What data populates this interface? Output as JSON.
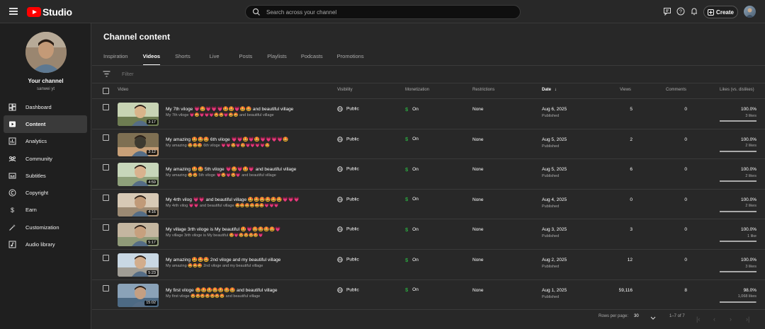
{
  "app": {
    "logo_text": "Studio"
  },
  "search": {
    "placeholder": "Search across your channel"
  },
  "topbar": {
    "create_label": "Create"
  },
  "channel": {
    "title": "Your channel",
    "handle": "sanwei yt"
  },
  "nav": [
    {
      "label": "Dashboard",
      "icon": "dashboard-icon"
    },
    {
      "label": "Content",
      "icon": "content-icon",
      "active": true
    },
    {
      "label": "Analytics",
      "icon": "analytics-icon"
    },
    {
      "label": "Community",
      "icon": "community-icon"
    },
    {
      "label": "Subtitles",
      "icon": "subtitles-icon"
    },
    {
      "label": "Copyright",
      "icon": "copyright-icon"
    },
    {
      "label": "Earn",
      "icon": "earn-icon"
    },
    {
      "label": "Customization",
      "icon": "customization-icon"
    },
    {
      "label": "Audio library",
      "icon": "audio-library-icon"
    }
  ],
  "page": {
    "title": "Channel content"
  },
  "tabs": [
    "Inspiration",
    "Videos",
    "Shorts",
    "Live",
    "Posts",
    "Playlists",
    "Podcasts",
    "Promotions"
  ],
  "active_tab": "Videos",
  "filter": {
    "placeholder": "Filter"
  },
  "columns": {
    "video": "Video",
    "visibility": "Visibility",
    "monetization": "Monetization",
    "restrictions": "Restrictions",
    "date": "Date",
    "views": "Views",
    "comments": "Comments",
    "likes": "Likes (vs. dislikes)"
  },
  "rows": [
    {
      "title": "My 7th viloge 💗🤩💗💗💗🤩🤩💗🤩🤩 and beautiful village",
      "desc": "My 7th viloge 💗🤩💗💗💗🤩🤩💗🤩🤩 and beautiful village",
      "duration": "3:17",
      "visibility": "Public",
      "monetization": "On",
      "restrictions": "None",
      "date": "Aug 6, 2025",
      "status": "Published",
      "views": "5",
      "comments": "0",
      "likes_pct": "100.0%",
      "likes": "3 likes",
      "like_ratio": 1.0
    },
    {
      "title": "My amazing 🤩🤩🤩 6th viloge 💗💗🤩💗🤩💗💗💗💗🤩",
      "desc": "My amazing 🤩🤩🤩 6th viloge 💗💗🤩💗🤩💗💗💗💗🤩",
      "duration": "3:12",
      "visibility": "Public",
      "monetization": "On",
      "restrictions": "None",
      "date": "Aug 5, 2025",
      "status": "Published",
      "views": "2",
      "comments": "0",
      "likes_pct": "100.0%",
      "likes": "2 likes",
      "like_ratio": 1.0
    },
    {
      "title": "My amazing 🤩🤩 5th viloge 💗🤩💗🤩💗 and beautiful village",
      "desc": "My amazing 🤩🤩 5th viloge 💗🤩💗🤩💗 and beautiful village",
      "duration": "4:59",
      "visibility": "Public",
      "monetization": "On",
      "restrictions": "None",
      "date": "Aug 5, 2025",
      "status": "Published",
      "views": "6",
      "comments": "0",
      "likes_pct": "100.0%",
      "likes": "2 likes",
      "like_ratio": 1.0
    },
    {
      "title": "My 4rth vilog 💗💗 and beautiful village 🤩🤩🤩🤩🤩🤩💗💗💗",
      "desc": "My 4rth vilog 💗💗 and beautiful village 🤩🤩🤩🤩🤩🤩💗💗💗",
      "duration": "4:16",
      "visibility": "Public",
      "monetization": "On",
      "restrictions": "None",
      "date": "Aug 4, 2025",
      "status": "Published",
      "views": "0",
      "comments": "0",
      "likes_pct": "100.0%",
      "likes": "2 likes",
      "like_ratio": 1.0
    },
    {
      "title": "My village 3rth viloge is My beautiful 🤩💗🤩🤩🤩🤩💗",
      "desc": "My village 3rth viloge is My beautiful 🤩💗🤩🤩🤩🤩💗",
      "duration": "5:17",
      "visibility": "Public",
      "monetization": "On",
      "restrictions": "None",
      "date": "Aug 3, 2025",
      "status": "Published",
      "views": "3",
      "comments": "0",
      "likes_pct": "100.0%",
      "likes": "1 like",
      "like_ratio": 1.0
    },
    {
      "title": "My amazing 🤩🤩🤩 2nd viloge and my beautiful village",
      "desc": "My amazing 🤩🤩🤩 2nd viloge and my beautiful village",
      "duration": "5:23",
      "visibility": "Public",
      "monetization": "On",
      "restrictions": "None",
      "date": "Aug 2, 2025",
      "status": "Published",
      "views": "12",
      "comments": "0",
      "likes_pct": "100.0%",
      "likes": "3 likes",
      "like_ratio": 1.0
    },
    {
      "title": "My first viloge 🤩🤩🤩🤩🤩🤩🤩 and beautiful village",
      "desc": "My first viloge 🤩🤩🤩🤩🤩🤩🤩 and beautiful village",
      "duration": "15:02",
      "visibility": "Public",
      "monetization": "On",
      "restrictions": "None",
      "date": "Aug 1, 2025",
      "status": "Published",
      "views": "59,116",
      "comments": "8",
      "likes_pct": "98.0%",
      "likes": "1,068 likes",
      "like_ratio": 0.98
    }
  ],
  "footer": {
    "rows_per_page_label": "Rows per page:",
    "rows_per_page": "30",
    "range": "1–7 of 7"
  },
  "colors": {
    "accent_red": "#ff0000",
    "monetization_green": "#2ba640",
    "background": "#282828"
  }
}
